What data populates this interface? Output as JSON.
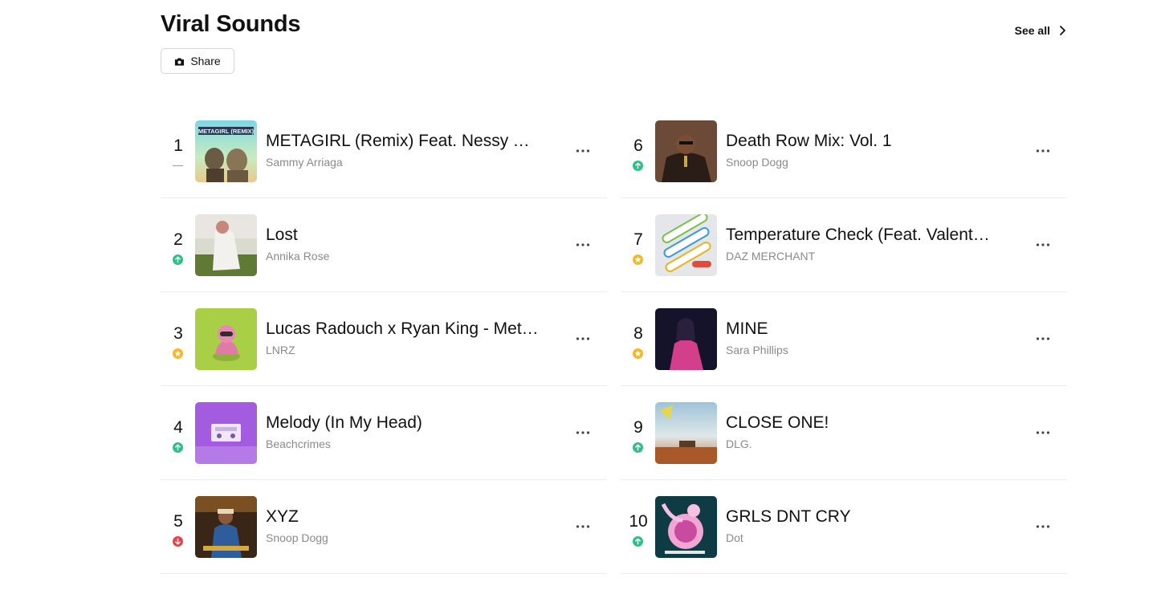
{
  "header": {
    "title": "Viral Sounds",
    "see_all_label": "See all",
    "share_label": "Share"
  },
  "colors": {
    "up": "#2cbf86",
    "down": "#e0454b",
    "new": "#f2b92c",
    "same": "#9a9a9a"
  },
  "tracks": [
    {
      "rank": "1",
      "title": "METAGIRL (Remix) Feat. Nessy Th…",
      "artist": "Sammy Arriaga",
      "trend": "same",
      "art_text": "METAGIRL (REMIX)"
    },
    {
      "rank": "2",
      "title": "Lost",
      "artist": "Annika Rose",
      "trend": "up"
    },
    {
      "rank": "3",
      "title": "Lucas Radouch x Ryan King - Met…",
      "artist": "LNRZ",
      "trend": "new"
    },
    {
      "rank": "4",
      "title": "Melody (In My Head)",
      "artist": "Beachcrimes",
      "trend": "up"
    },
    {
      "rank": "5",
      "title": "XYZ",
      "artist": "Snoop Dogg",
      "trend": "down"
    },
    {
      "rank": "6",
      "title": "Death Row Mix: Vol. 1",
      "artist": "Snoop Dogg",
      "trend": "up"
    },
    {
      "rank": "7",
      "title": "Temperature Check (Feat. Valent…",
      "artist": "DAZ MERCHANT",
      "trend": "new"
    },
    {
      "rank": "8",
      "title": "MINE",
      "artist": "Sara Phillips",
      "trend": "new"
    },
    {
      "rank": "9",
      "title": "CLOSE ONE!",
      "artist": "DLG.",
      "trend": "up"
    },
    {
      "rank": "10",
      "title": "GRLS DNT CRY",
      "artist": "Dot",
      "trend": "up"
    }
  ]
}
